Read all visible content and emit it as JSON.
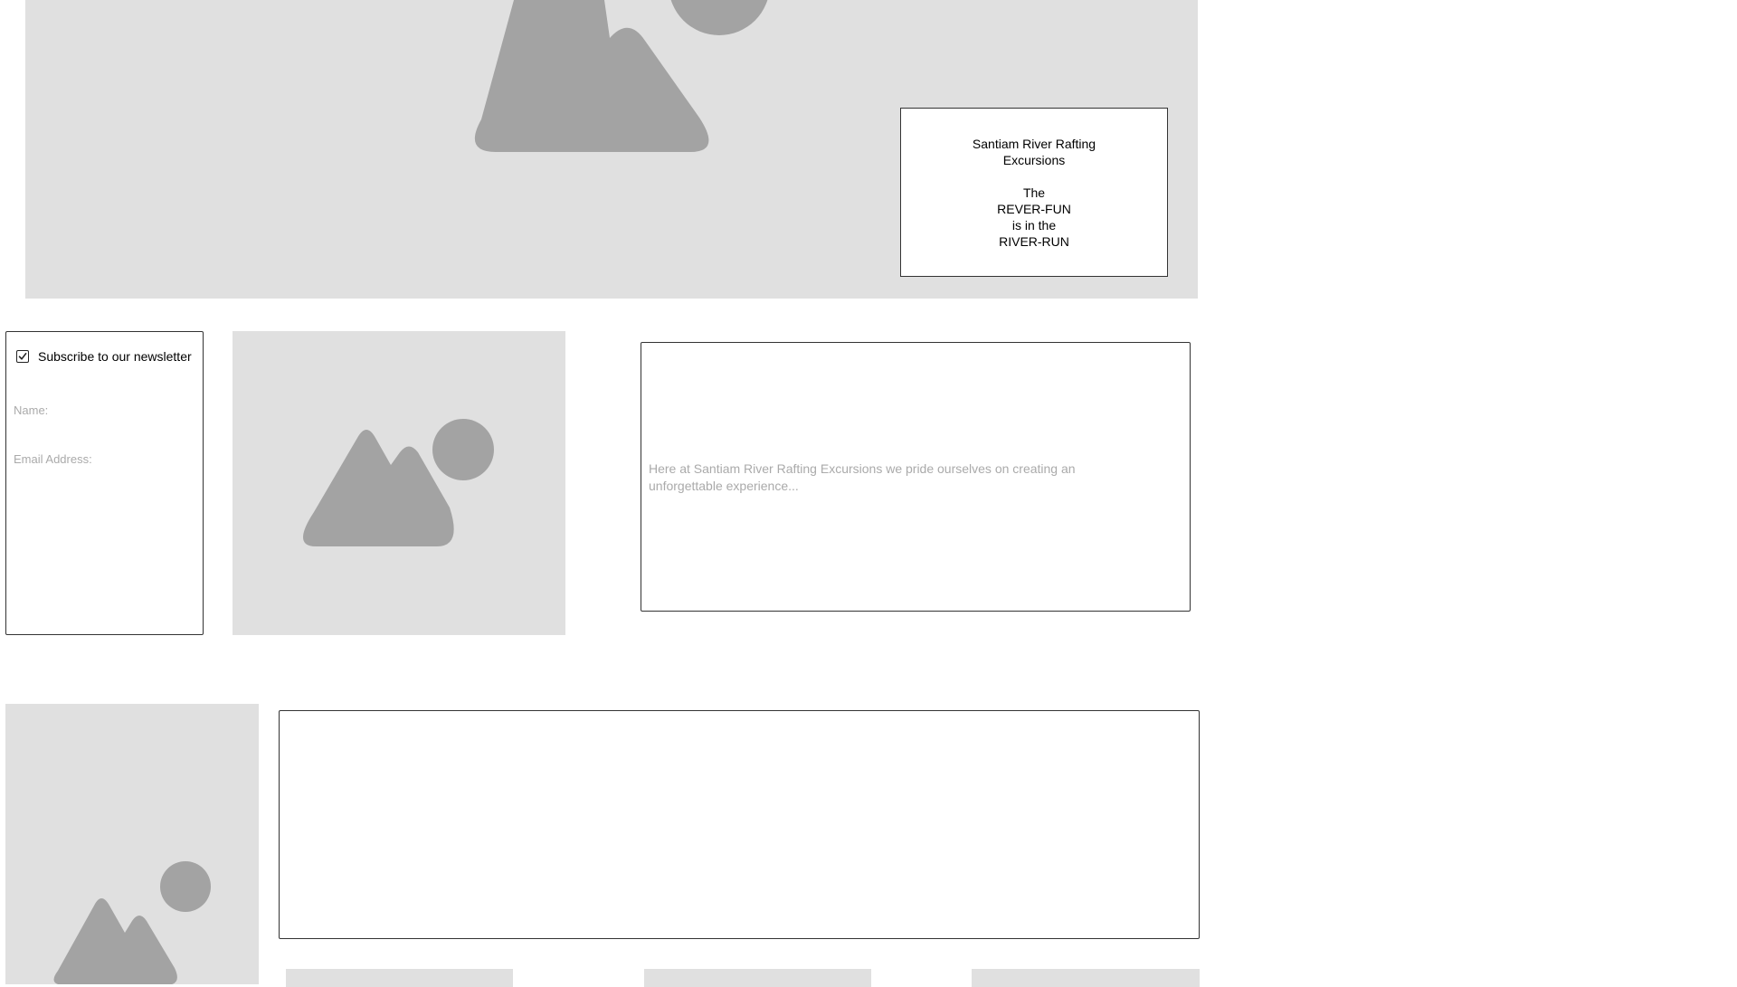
{
  "hero": {
    "image_icon": "image-placeholder-icon",
    "card": {
      "title_line_1": "Santiam River Rafting",
      "title_line_2": "Excursions",
      "slogan_line_1": "The",
      "slogan_line_2": "REVER-FUN",
      "slogan_line_3": "is in the",
      "slogan_line_4": "RIVER-RUN"
    }
  },
  "newsletter": {
    "checkbox_label": "Subscribe to our newsletter",
    "checked": true,
    "name_placeholder": "Name:",
    "email_placeholder": "Email Address:"
  },
  "intro": {
    "text": "Here at Santiam River Rafting Excursions we pride ourselves on creating an unforgettable experience..."
  },
  "colors": {
    "placeholder_bg": "#e0e0e0",
    "placeholder_shape": "#a3a3a3",
    "border": "#333333",
    "muted_text": "#aaaaaa"
  }
}
